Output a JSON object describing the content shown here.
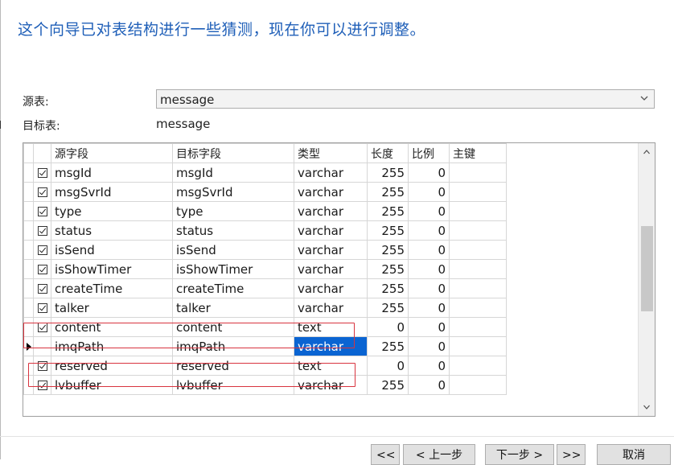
{
  "heading": "这个向导已对表结构进行一些猜测，现在你可以进行调整。",
  "source_table": {
    "label": "源表:",
    "value": "message"
  },
  "target_table": {
    "label": "目标表:",
    "value": "message"
  },
  "grid": {
    "headers": [
      "源字段",
      "目标字段",
      "类型",
      "长度",
      "比例",
      "主键"
    ],
    "rows": [
      {
        "checked": true,
        "source": "msgId",
        "target": "msgId",
        "type": "varchar",
        "length": "255",
        "scale": "0",
        "pk": ""
      },
      {
        "checked": true,
        "source": "msgSvrId",
        "target": "msgSvrId",
        "type": "varchar",
        "length": "255",
        "scale": "0",
        "pk": ""
      },
      {
        "checked": true,
        "source": "type",
        "target": "type",
        "type": "varchar",
        "length": "255",
        "scale": "0",
        "pk": ""
      },
      {
        "checked": true,
        "source": "status",
        "target": "status",
        "type": "varchar",
        "length": "255",
        "scale": "0",
        "pk": ""
      },
      {
        "checked": true,
        "source": "isSend",
        "target": "isSend",
        "type": "varchar",
        "length": "255",
        "scale": "0",
        "pk": ""
      },
      {
        "checked": true,
        "source": "isShowTimer",
        "target": "isShowTimer",
        "type": "varchar",
        "length": "255",
        "scale": "0",
        "pk": ""
      },
      {
        "checked": true,
        "source": "createTime",
        "target": "createTime",
        "type": "varchar",
        "length": "255",
        "scale": "0",
        "pk": ""
      },
      {
        "checked": true,
        "source": "talker",
        "target": "talker",
        "type": "varchar",
        "length": "255",
        "scale": "0",
        "pk": ""
      },
      {
        "checked": true,
        "source": "content",
        "target": "content",
        "type": "text",
        "length": "0",
        "scale": "0",
        "pk": ""
      },
      {
        "checked": false,
        "current": true,
        "source": "imqPath",
        "target": "imqPath",
        "type": "varchar",
        "length": "255",
        "scale": "0",
        "pk": "",
        "type_selected": true
      },
      {
        "checked": true,
        "source": "reserved",
        "target": "reserved",
        "type": "text",
        "length": "0",
        "scale": "0",
        "pk": ""
      },
      {
        "checked": true,
        "source": "lvbuffer",
        "target": "lvbuffer",
        "type": "varchar",
        "length": "255",
        "scale": "0",
        "pk": ""
      }
    ]
  },
  "buttons": {
    "first": "<<",
    "prev": "< 上一步",
    "next": "下一步 >",
    "last": ">>",
    "cancel": "取消"
  },
  "colors": {
    "heading": "#1f5fb8",
    "highlight": "#d8343f",
    "selection": "#0a64d2"
  }
}
